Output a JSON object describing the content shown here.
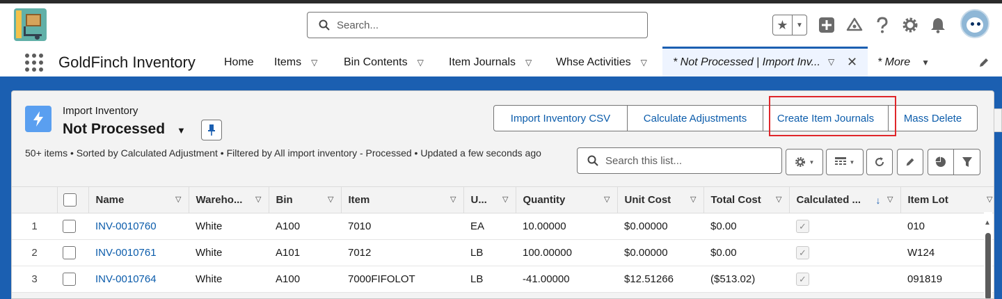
{
  "header": {
    "search_placeholder": "Search..."
  },
  "nav": {
    "app_name": "GoldFinch Inventory",
    "items": [
      {
        "label": "Home"
      },
      {
        "label": "Items"
      },
      {
        "label": "Bin Contents"
      },
      {
        "label": "Item Journals"
      },
      {
        "label": "Whse Activities"
      }
    ],
    "active_tab": "* Not Processed | Import Inv...",
    "more_label": "* More"
  },
  "list": {
    "object_type": "Import Inventory",
    "name": "Not Processed",
    "buttons": [
      "Import Inventory CSV",
      "Calculate Adjustments",
      "Create Item Journals",
      "Mass Delete"
    ],
    "meta": "50+ items • Sorted by Calculated Adjustment • Filtered by All import inventory - Processed • Updated a few seconds ago",
    "search_placeholder": "Search this list..."
  },
  "table": {
    "columns": [
      "Name",
      "Wareho...",
      "Bin",
      "Item",
      "U...",
      "Quantity",
      "Unit Cost",
      "Total Cost",
      "Calculated ...",
      "Item Lot"
    ],
    "rows": [
      {
        "num": "1",
        "name": "INV-0010760",
        "warehouse": "White",
        "bin": "A100",
        "item": "7010",
        "uom": "EA",
        "quantity": "10.00000",
        "unit_cost": "$0.00000",
        "total_cost": "$0.00",
        "calculated": true,
        "item_lot": "010"
      },
      {
        "num": "2",
        "name": "INV-0010761",
        "warehouse": "White",
        "bin": "A101",
        "item": "7012",
        "uom": "LB",
        "quantity": "100.00000",
        "unit_cost": "$0.00000",
        "total_cost": "$0.00",
        "calculated": true,
        "item_lot": "W124"
      },
      {
        "num": "3",
        "name": "INV-0010764",
        "warehouse": "White",
        "bin": "A100",
        "item": "7000FIFOLOT",
        "uom": "LB",
        "quantity": "-41.00000",
        "unit_cost": "$12.51266",
        "total_cost": "($513.02)",
        "calculated": true,
        "item_lot": "091819"
      }
    ]
  },
  "colors": {
    "brand": "#1b5fb1",
    "link": "#0b5cab",
    "highlight": "#e0262a"
  }
}
